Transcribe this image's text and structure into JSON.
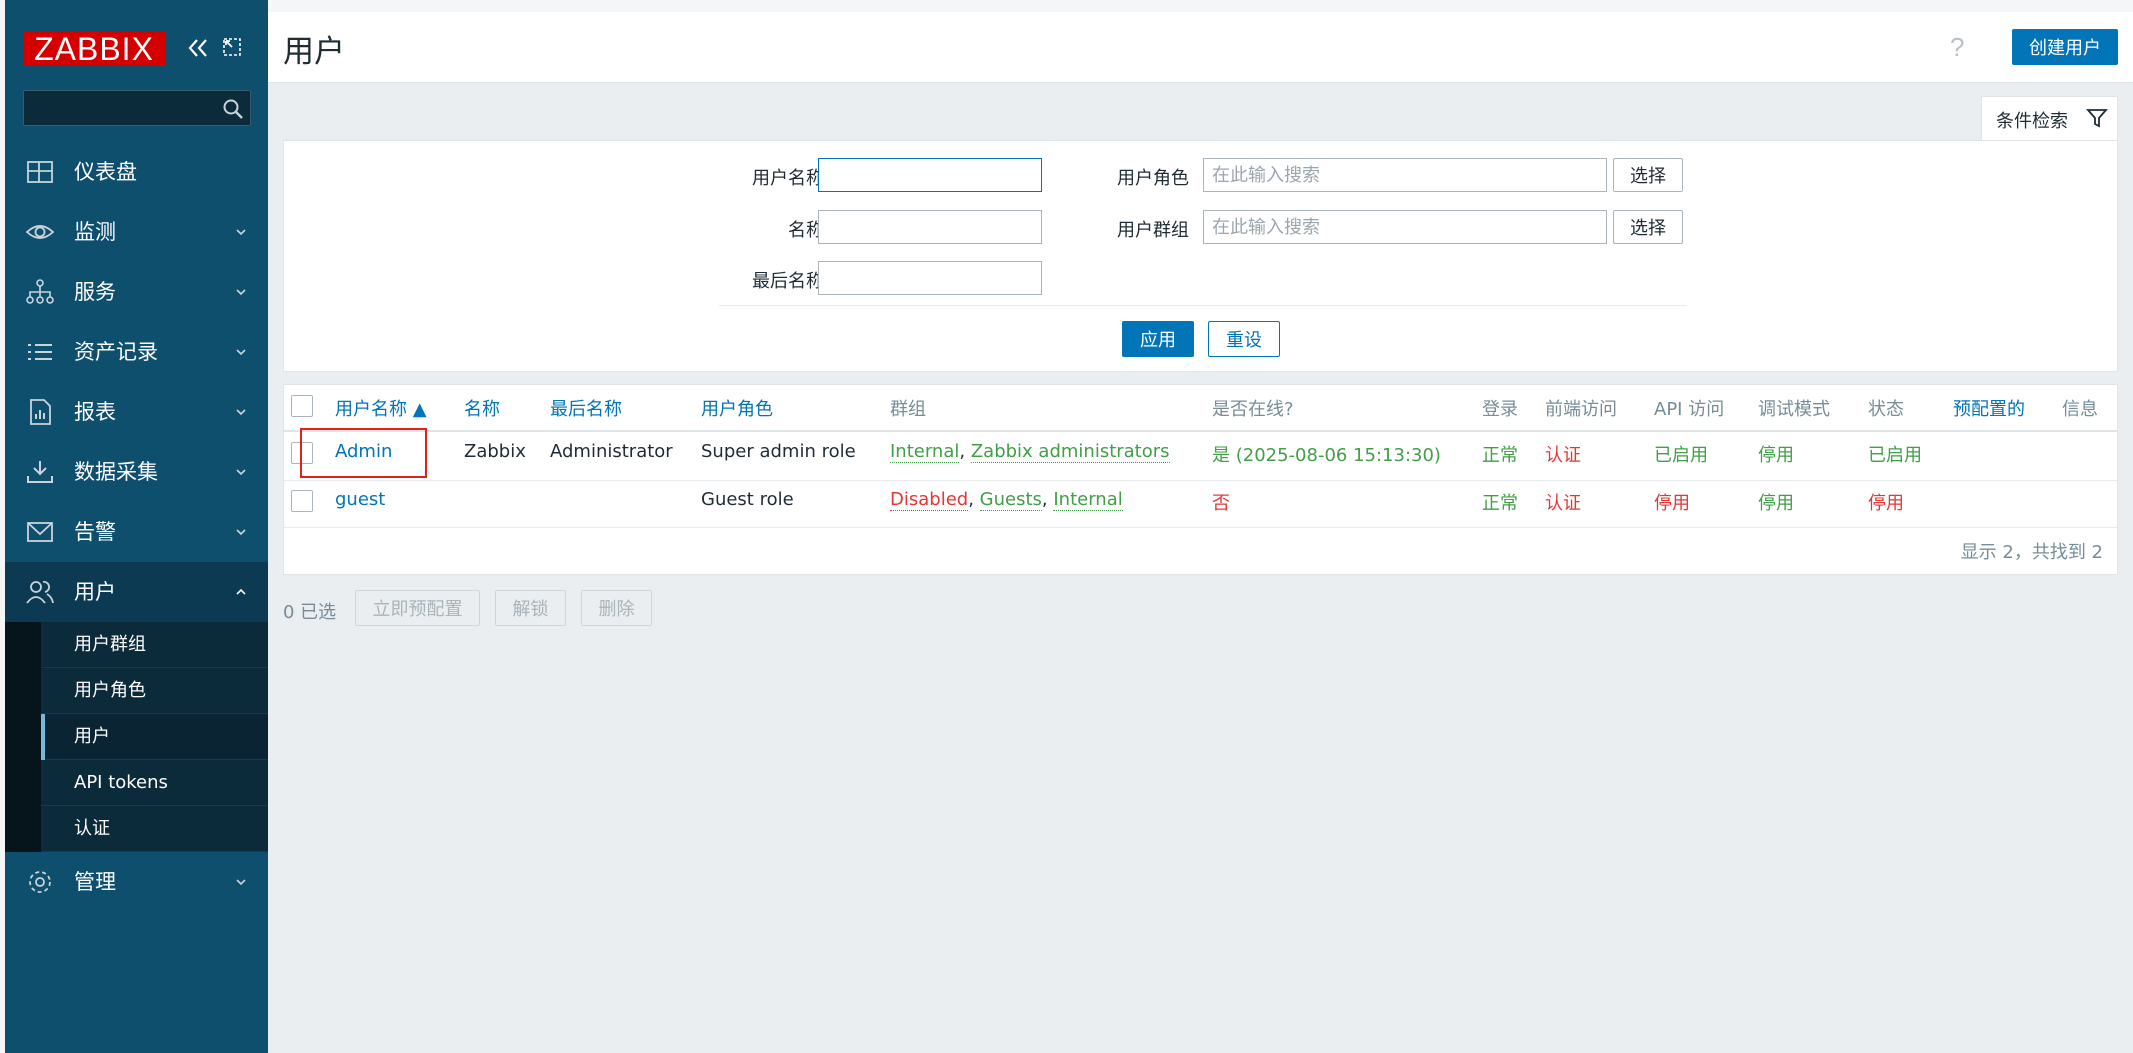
{
  "sidebar": {
    "logo": "ZABBIX",
    "search": {
      "value": "",
      "placeholder": ""
    },
    "items": [
      {
        "label": "仪表盘",
        "icon": "dashboard-icon"
      },
      {
        "label": "监测",
        "icon": "eye-icon"
      },
      {
        "label": "服务",
        "icon": "hierarchy-icon"
      },
      {
        "label": "资产记录",
        "icon": "list-icon"
      },
      {
        "label": "报表",
        "icon": "report-icon"
      },
      {
        "label": "数据采集",
        "icon": "download-icon"
      },
      {
        "label": "告警",
        "icon": "envelope-icon"
      },
      {
        "label": "用户",
        "icon": "users-icon"
      },
      {
        "label": "管理",
        "icon": "gear-icon"
      }
    ],
    "subitems": [
      "用户群组",
      "用户角色",
      "用户",
      "API tokens",
      "认证"
    ]
  },
  "header": {
    "title": "用户",
    "help": "?",
    "create_button": "创建用户"
  },
  "filter": {
    "tab_label": "条件检索",
    "username_label": "用户名称",
    "username_value": "",
    "name_label": "名称",
    "name_value": "",
    "surname_label": "最后名称",
    "surname_value": "",
    "role_label": "用户角色",
    "role_placeholder": "在此输入搜索",
    "group_label": "用户群组",
    "group_placeholder": "在此输入搜索",
    "select_label": "选择",
    "apply": "应用",
    "reset": "重设"
  },
  "table": {
    "columns": [
      "用户名称 ▲",
      "名称",
      "最后名称",
      "用户角色",
      "群组",
      "是否在线?",
      "登录",
      "前端访问",
      "API 访问",
      "调试模式",
      "状态",
      "预配置的",
      "信息"
    ],
    "rows": [
      {
        "username": "Admin",
        "name": "Zabbix",
        "surname": "Administrator",
        "role": "Super admin role",
        "groups": [
          "Internal",
          "Zabbix administrators"
        ],
        "online": "是 (2025-08-06 15:13:30)",
        "login": "正常",
        "frontend": "认证",
        "api": "已启用",
        "debug": "停用",
        "status": "已启用"
      },
      {
        "username": "guest",
        "name": "",
        "surname": "",
        "role": "Guest role",
        "groups": [
          "Disabled",
          "Guests",
          "Internal"
        ],
        "online": "否",
        "login": "正常",
        "frontend": "认证",
        "api": "停用",
        "debug": "停用",
        "status": "停用"
      }
    ],
    "footer": "显示 2，共找到 2"
  },
  "actions": {
    "selected": "0 已选",
    "provision": "立即预配置",
    "unlock": "解锁",
    "delete": "删除"
  },
  "colors": {
    "sidebar": "#0e4f6e",
    "accent": "#0275b8",
    "green": "#429e47",
    "red": "#e33734",
    "logo": "#d40000"
  }
}
